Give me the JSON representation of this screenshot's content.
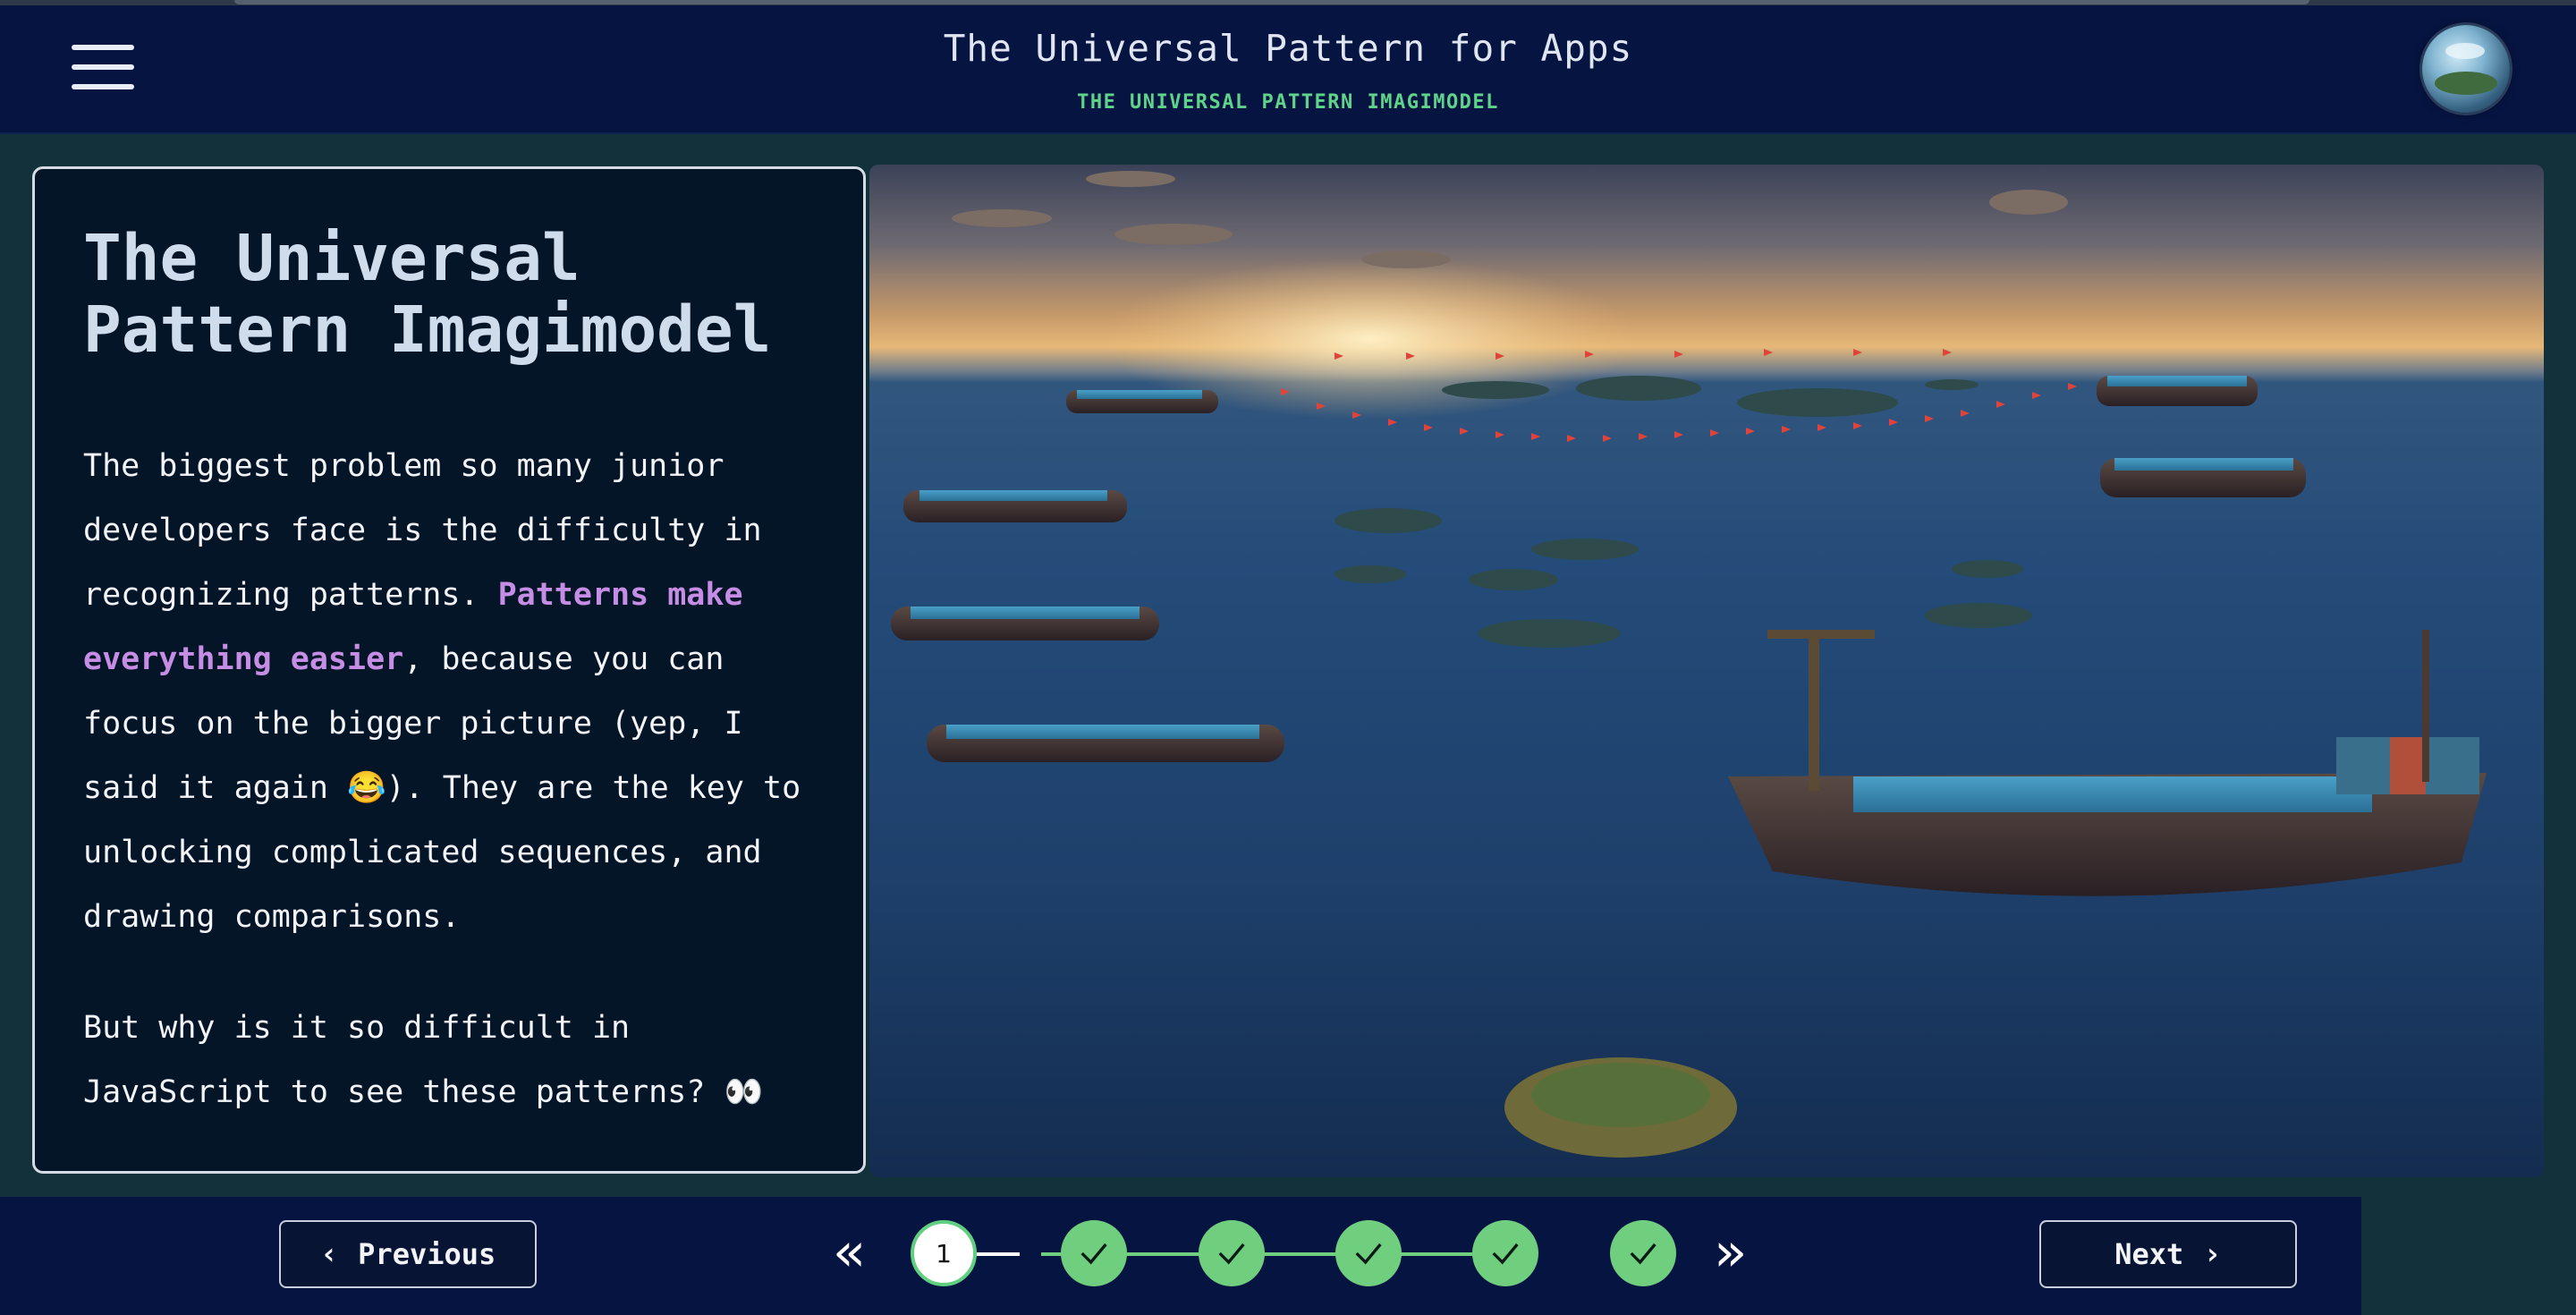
{
  "header": {
    "title": "The Universal Pattern for Apps",
    "subtitle": "THE UNIVERSAL PATTERN IMAGIMODEL"
  },
  "card": {
    "title_line1": "The Universal",
    "title_line2": "Pattern Imagimodel",
    "p1_before": "The biggest problem so many junior developers face is the difficulty in recognizing patterns. ",
    "p1_highlight": "Patterns make everything easier",
    "p1_after": ", because you can focus on the bigger picture (yep, I said it again 😂). They are the key to unlocking complicated sequences, and drawing comparisons.",
    "p2": "But why is it so difficult in JavaScript to see these patterns? 👀"
  },
  "nav": {
    "previous_label": "Previous",
    "next_label": "Next",
    "current_step": "1",
    "steps_total": 6,
    "completed_steps": 5
  },
  "colors": {
    "header_bg": "#061441",
    "accent_green": "#5fd38a",
    "highlight_purple": "#c58de3",
    "card_bg": "#051528"
  },
  "icons": {
    "menu": "hamburger-menu-icon",
    "first": "double-chevron-left-icon",
    "last": "double-chevron-right-icon",
    "done": "checkmark-icon"
  }
}
